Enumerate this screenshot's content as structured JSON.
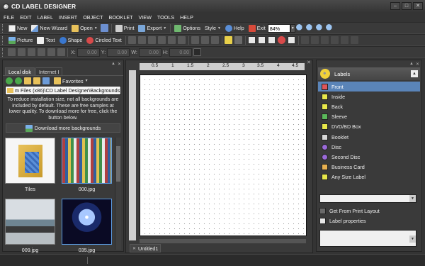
{
  "app": {
    "title": "CD LABEL DESIGNER"
  },
  "menu": [
    "FILE",
    "EDIT",
    "LABEL",
    "INSERT",
    "OBJECT",
    "BOOKLET",
    "VIEW",
    "TOOLS",
    "HELP"
  ],
  "toolbar1": {
    "new": "New",
    "new_wizard": "New Wizard",
    "open": "Open",
    "print": "Print",
    "export": "Export",
    "options": "Options",
    "style": "Style",
    "help": "Help",
    "exit": "Exit",
    "zoom": "84%"
  },
  "toolbar2": {
    "picture": "Picture",
    "text": "Text",
    "shape": "Shape",
    "circled_text": "Circled Text"
  },
  "toolbar3": {
    "x_label": "X:",
    "x_value": "0.00",
    "y_label": "Y:",
    "y_value": "0.00",
    "w_label": "W:",
    "w_value": "0.00",
    "h_label": "H:",
    "h_value": "0.00"
  },
  "left_panel": {
    "tabs": [
      "Local disk",
      "Internet I"
    ],
    "favorites": "Favorites",
    "path": "m Files (x86)\\CD Label Designer\\Backgrounds",
    "info": "To reduce installation size, not all backgrounds are included by default. These are free samples at lower quality. To download more for free, click the button below.",
    "download_button": "Download more backgrounds",
    "thumbs": [
      {
        "caption": "Tiles"
      },
      {
        "caption": "000.jpg"
      },
      {
        "caption": "009.jpg"
      },
      {
        "caption": "035.jpg"
      }
    ]
  },
  "ruler_labels": [
    "0.5",
    "1",
    "1.5",
    "2",
    "2.5",
    "3",
    "3.5",
    "4",
    "4.5"
  ],
  "document": {
    "tab": "Untitled1"
  },
  "right_panel": {
    "header": "Labels",
    "items": [
      {
        "label": "Front",
        "color": "#e0555a"
      },
      {
        "label": "Inside",
        "color": "#e8e84a"
      },
      {
        "label": "Back",
        "color": "#e8e84a"
      },
      {
        "label": "Sleeve",
        "color": "#5ab85a"
      },
      {
        "label": "DVD/BD Box",
        "color": "#e8e84a"
      },
      {
        "label": "Booklet",
        "color": "#d8d8d8"
      },
      {
        "label": "Disc",
        "color": "#9a6ad8"
      },
      {
        "label": "Second Disc",
        "color": "#9a6ad8"
      },
      {
        "label": "Business Card",
        "color": "#e8b050"
      },
      {
        "label": "Any Size Label",
        "color": "#e8e84a"
      }
    ],
    "get_from_print": "Get From Print Layout",
    "label_properties": "Label properties"
  },
  "colors": {
    "selected": "#5a84b8",
    "background": "#343434",
    "accent": "#f2d23a"
  }
}
